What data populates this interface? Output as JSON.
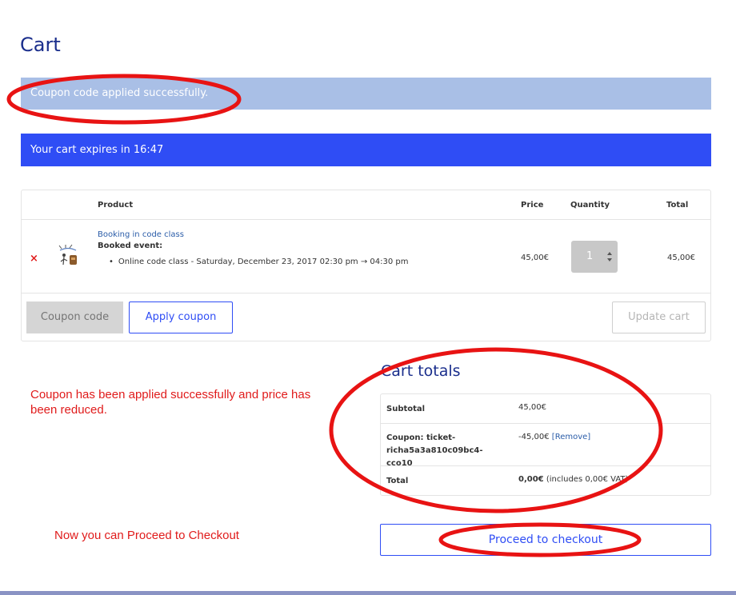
{
  "page": {
    "title": "Cart"
  },
  "notices": {
    "success": "Coupon code applied successfully.",
    "expires": "Your cart expires in 16:47"
  },
  "cart": {
    "headers": {
      "product": "Product",
      "price": "Price",
      "quantity": "Quantity",
      "total": "Total"
    },
    "item": {
      "remove_symbol": "×",
      "name": "Booking in code class",
      "booked_label": "Booked event:",
      "booked_detail": "Online code class - Saturday, December 23, 2017 02:30 pm → 04:30 pm",
      "price": "45,00€",
      "quantity": "1",
      "total": "45,00€"
    },
    "coupon_placeholder": "Coupon code",
    "apply_label": "Apply coupon",
    "update_label": "Update cart"
  },
  "totals": {
    "title": "Cart totals",
    "subtotal_label": "Subtotal",
    "subtotal_value": "45,00€",
    "coupon_label": "Coupon: ticket-richa5a3a810c09bc4-cco10",
    "coupon_value": "-45,00€",
    "coupon_remove": "[Remove]",
    "total_label": "Total",
    "total_value": "0,00€",
    "total_note": " (includes 0,00€ VAT)"
  },
  "checkout_label": "Proceed to checkout",
  "annotations": {
    "coupon_note": "Coupon has been applied successfully and price has been reduced.",
    "proceed_note": "Now you can Proceed to Checkout"
  },
  "colors": {
    "accent": "#2f4df5",
    "title": "#1a2e8c",
    "success_bg": "#a9bfe6",
    "annotation": "#e01b1b"
  }
}
